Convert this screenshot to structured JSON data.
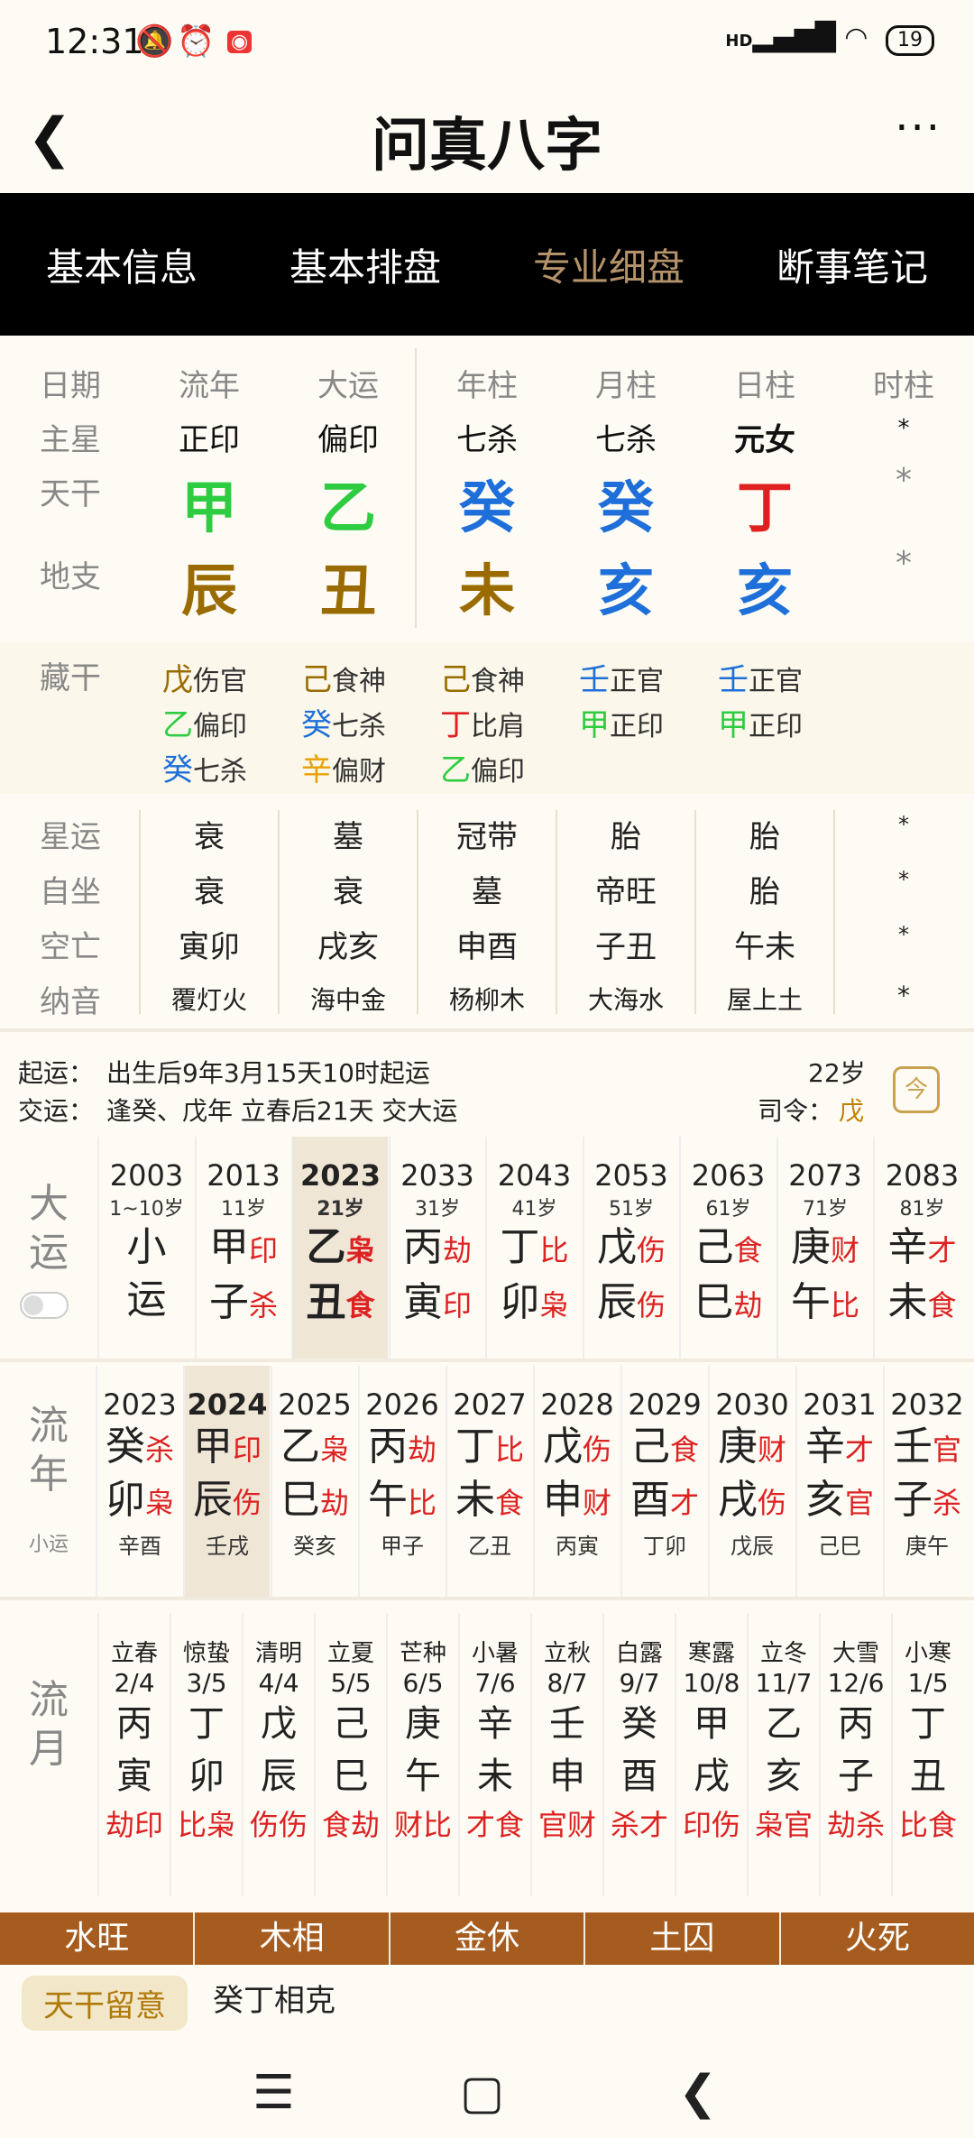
{
  "status": {
    "time": "12:31",
    "battery": "19",
    "network": "HD"
  },
  "header": {
    "title": "问真八字"
  },
  "tabs": [
    "基本信息",
    "基本排盘",
    "专业细盘",
    "断事笔记"
  ],
  "active_tab": "专业细盘",
  "pillar_headers": [
    "日期",
    "流年",
    "大运",
    "年柱",
    "月柱",
    "日柱",
    "时柱"
  ],
  "zhuxing": {
    "label": "主星",
    "values": [
      "正印",
      "偏印",
      "七杀",
      "七杀",
      "元女",
      "*"
    ]
  },
  "tiangan": {
    "label": "天干",
    "values": [
      "甲",
      "乙",
      "癸",
      "癸",
      "丁",
      "*"
    ],
    "colors": [
      "#2ecc40",
      "#2ecc40",
      "#1e6fd9",
      "#1e6fd9",
      "#e02020",
      "#888"
    ]
  },
  "dizhi": {
    "label": "地支",
    "values": [
      "辰",
      "丑",
      "未",
      "亥",
      "亥",
      "*"
    ],
    "colors": [
      "#9a6b00",
      "#9a6b00",
      "#9a6b00",
      "#1e6fd9",
      "#1e6fd9",
      "#888"
    ]
  },
  "canggan": {
    "label": "藏干",
    "cols": [
      [
        {
          "g": "戊",
          "s": "伤官",
          "c": "#9a6b00"
        },
        {
          "g": "乙",
          "s": "偏印",
          "c": "#2ecc40"
        },
        {
          "g": "癸",
          "s": "七杀",
          "c": "#1e6fd9"
        }
      ],
      [
        {
          "g": "己",
          "s": "食神",
          "c": "#9a6b00"
        },
        {
          "g": "癸",
          "s": "七杀",
          "c": "#1e6fd9"
        },
        {
          "g": "辛",
          "s": "偏财",
          "c": "#e8a000"
        }
      ],
      [
        {
          "g": "己",
          "s": "食神",
          "c": "#9a6b00"
        },
        {
          "g": "丁",
          "s": "比肩",
          "c": "#e02020"
        },
        {
          "g": "乙",
          "s": "偏印",
          "c": "#2ecc40"
        }
      ],
      [
        {
          "g": "壬",
          "s": "正官",
          "c": "#1e6fd9"
        },
        {
          "g": "甲",
          "s": "正印",
          "c": "#2ecc40"
        }
      ],
      [
        {
          "g": "壬",
          "s": "正官",
          "c": "#1e6fd9"
        },
        {
          "g": "甲",
          "s": "正印",
          "c": "#2ecc40"
        }
      ]
    ]
  },
  "xingyun": {
    "label": "星运",
    "values": [
      "衰",
      "墓",
      "冠带",
      "胎",
      "胎",
      "*"
    ]
  },
  "zizuo": {
    "label": "自坐",
    "values": [
      "衰",
      "衰",
      "墓",
      "帝旺",
      "胎",
      "*"
    ]
  },
  "kongwang": {
    "label": "空亡",
    "values": [
      "寅卯",
      "戌亥",
      "申酉",
      "子丑",
      "午未",
      "*"
    ]
  },
  "nayin": {
    "label": "纳音",
    "values": [
      "覆灯火",
      "海中金",
      "杨柳木",
      "大海水",
      "屋上土",
      "*"
    ]
  },
  "qiyun": {
    "label": "起运：",
    "text": "出生后9年3月15天10时起运",
    "age": "22岁"
  },
  "jiaoyun": {
    "label": "交运：",
    "text": "逢癸、戊年 立春后21天 交大运",
    "siling_label": "司令：",
    "siling": "戊"
  },
  "dayun": {
    "label": "大运",
    "cols": [
      {
        "yr": "2003",
        "age": "1~10岁",
        "g": "小",
        "z": "运",
        "gt": "",
        "zt": ""
      },
      {
        "yr": "2013",
        "age": "11岁",
        "g": "甲",
        "z": "子",
        "gt": "印",
        "zt": "杀"
      },
      {
        "yr": "2023",
        "age": "21岁",
        "g": "乙",
        "z": "丑",
        "gt": "枭",
        "zt": "食"
      },
      {
        "yr": "2033",
        "age": "31岁",
        "g": "丙",
        "z": "寅",
        "gt": "劫",
        "zt": "印"
      },
      {
        "yr": "2043",
        "age": "41岁",
        "g": "丁",
        "z": "卯",
        "gt": "比",
        "zt": "枭"
      },
      {
        "yr": "2053",
        "age": "51岁",
        "g": "戊",
        "z": "辰",
        "gt": "伤",
        "zt": "伤"
      },
      {
        "yr": "2063",
        "age": "61岁",
        "g": "己",
        "z": "巳",
        "gt": "食",
        "zt": "劫"
      },
      {
        "yr": "2073",
        "age": "71岁",
        "g": "庚",
        "z": "午",
        "gt": "财",
        "zt": "比"
      },
      {
        "yr": "2083",
        "age": "81岁",
        "g": "辛",
        "z": "未",
        "gt": "才",
        "zt": "食"
      }
    ]
  },
  "liunian": {
    "label": "流年",
    "sublabel": "小运",
    "cols": [
      {
        "yr": "2023",
        "g": "癸",
        "z": "卯",
        "gt": "杀",
        "zt": "枭",
        "sub": "辛酉"
      },
      {
        "yr": "2024",
        "g": "甲",
        "z": "辰",
        "gt": "印",
        "zt": "伤",
        "sub": "壬戌"
      },
      {
        "yr": "2025",
        "g": "乙",
        "z": "巳",
        "gt": "枭",
        "zt": "劫",
        "sub": "癸亥"
      },
      {
        "yr": "2026",
        "g": "丙",
        "z": "午",
        "gt": "劫",
        "zt": "比",
        "sub": "甲子"
      },
      {
        "yr": "2027",
        "g": "丁",
        "z": "未",
        "gt": "比",
        "zt": "食",
        "sub": "乙丑"
      },
      {
        "yr": "2028",
        "g": "戊",
        "z": "申",
        "gt": "伤",
        "zt": "财",
        "sub": "丙寅"
      },
      {
        "yr": "2029",
        "g": "己",
        "z": "酉",
        "gt": "食",
        "zt": "才",
        "sub": "丁卯"
      },
      {
        "yr": "2030",
        "g": "庚",
        "z": "戌",
        "gt": "财",
        "zt": "伤",
        "sub": "戊辰"
      },
      {
        "yr": "2031",
        "g": "辛",
        "z": "亥",
        "gt": "才",
        "zt": "官",
        "sub": "己巳"
      },
      {
        "yr": "2032",
        "g": "壬",
        "z": "子",
        "gt": "官",
        "zt": "杀",
        "sub": "庚午"
      }
    ]
  },
  "liuyue": {
    "label": "流月",
    "cols": [
      {
        "jq": "立春",
        "dt": "2/4",
        "g": "丙",
        "z": "寅",
        "ss": "劫印"
      },
      {
        "jq": "惊蛰",
        "dt": "3/5",
        "g": "丁",
        "z": "卯",
        "ss": "比枭"
      },
      {
        "jq": "清明",
        "dt": "4/4",
        "g": "戊",
        "z": "辰",
        "ss": "伤伤"
      },
      {
        "jq": "立夏",
        "dt": "5/5",
        "g": "己",
        "z": "巳",
        "ss": "食劫"
      },
      {
        "jq": "芒种",
        "dt": "6/5",
        "g": "庚",
        "z": "午",
        "ss": "财比"
      },
      {
        "jq": "小暑",
        "dt": "7/6",
        "g": "辛",
        "z": "未",
        "ss": "才食"
      },
      {
        "jq": "立秋",
        "dt": "8/7",
        "g": "壬",
        "z": "申",
        "ss": "官财"
      },
      {
        "jq": "白露",
        "dt": "9/7",
        "g": "癸",
        "z": "酉",
        "ss": "杀才"
      },
      {
        "jq": "寒露",
        "dt": "10/8",
        "g": "甲",
        "z": "戌",
        "ss": "印伤"
      },
      {
        "jq": "立冬",
        "dt": "11/7",
        "g": "乙",
        "z": "亥",
        "ss": "枭官"
      },
      {
        "jq": "大雪",
        "dt": "12/6",
        "g": "丙",
        "z": "子",
        "ss": "劫杀"
      },
      {
        "jq": "小寒",
        "dt": "1/5",
        "g": "丁",
        "z": "丑",
        "ss": "比食"
      }
    ]
  },
  "wuxing": [
    "水旺",
    "木相",
    "金休",
    "土囚",
    "火死"
  ],
  "tiangan_note": {
    "tag": "天干留意",
    "text": "癸丁相克"
  }
}
